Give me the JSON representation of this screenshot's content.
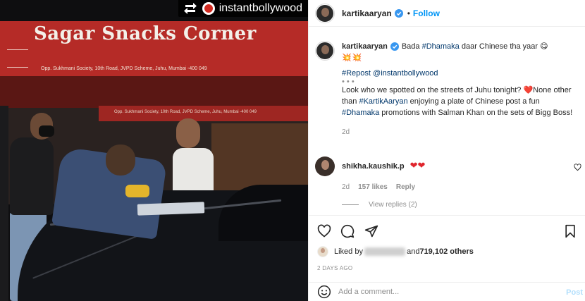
{
  "repost_badge": {
    "handle": "instantbollywood"
  },
  "photo": {
    "sign_name": "Sagar Snacks Corner",
    "sign_address": "Opp. Sukhmani Society, 10th Road, JVPD Scheme, Juhu, Mumbai -400 049",
    "sign2_address": "Opp. Sukhmani Society, 10th Road, JVPD Scheme, Juhu, Mumbai -400 049"
  },
  "header": {
    "username": "kartikaaryan",
    "separator": "•",
    "follow_label": "Follow"
  },
  "caption": {
    "username": "kartikaaryan",
    "text_pre": "Bada ",
    "hashtag1": "#Dhamaka",
    "text_post": " daar Chinese tha yaar ",
    "emoji_face": "😋",
    "emoji_boom": "💥💥",
    "repost_tag": "#Repost",
    "repost_mention": "@instantbollywood",
    "dots": "• • •",
    "line2_pre": "Look who we spotted on the streets of Juhu tonight? ",
    "heart": "❤️",
    "line2_mid": "None other than ",
    "hashtag2": "#KartikAaryan",
    "line2_mid2": " enjoying a plate of Chinese post a fun ",
    "hashtag3": "#Dhamaka",
    "line2_end": " promotions with Salman Khan on the sets of Bigg Boss!",
    "timestamp": "2d"
  },
  "comment": {
    "username": "shikha.kaushik.p",
    "hearts": "❤❤",
    "time": "2d",
    "likes": "157 likes",
    "reply_label": "Reply",
    "view_replies": "View replies (2)"
  },
  "likes": {
    "prefix": "Liked by ",
    "user_blurred": "aktajashuss",
    "connector": " and ",
    "count": "719,102 others"
  },
  "date": "2 DAYS AGO",
  "add_comment": {
    "placeholder": "Add a comment...",
    "post_label": "Post"
  },
  "colors": {
    "link": "#00376b",
    "follow": "#0095f6",
    "muted": "#8e8e8e",
    "heart": "#e0252d"
  }
}
